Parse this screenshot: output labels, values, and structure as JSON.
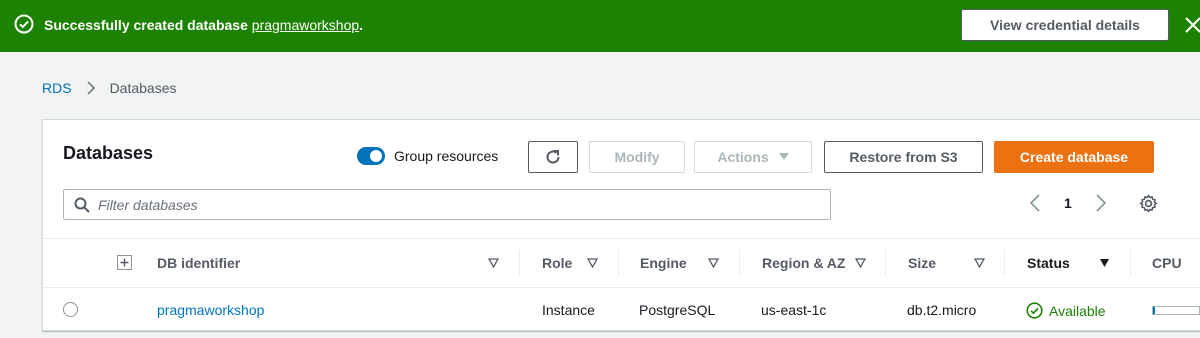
{
  "flash": {
    "message_prefix": "Successfully created database ",
    "database_link": "pragmaworkshop",
    "message_suffix": ".",
    "button_label": "View credential details",
    "color": "#1d8102"
  },
  "breadcrumb": {
    "root": "RDS",
    "current": "Databases"
  },
  "panel": {
    "title": "Databases",
    "group_resources_label": "Group resources",
    "group_resources_enabled": true,
    "buttons": {
      "modify": "Modify",
      "actions": "Actions",
      "restore": "Restore from S3",
      "create": "Create database"
    },
    "filter_placeholder": "Filter databases",
    "page_number": "1",
    "accent_color": "#ec7211"
  },
  "table": {
    "headers": {
      "db_identifier": "DB identifier",
      "role": "Role",
      "engine": "Engine",
      "region": "Region & AZ",
      "size": "Size",
      "status": "Status",
      "cpu": "CPU"
    },
    "rows": [
      {
        "db_identifier": "pragmaworkshop",
        "role": "Instance",
        "engine": "PostgreSQL",
        "region": "us-east-1c",
        "size": "db.t2.micro",
        "status": "Available",
        "cpu_fraction": 0.05
      }
    ]
  }
}
